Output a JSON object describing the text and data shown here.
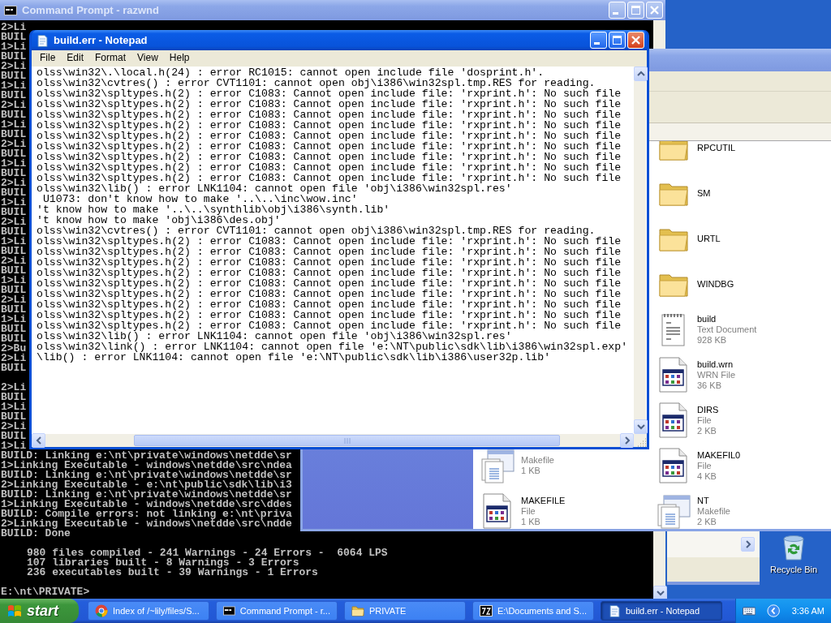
{
  "command_prompt": {
    "title": "Command Prompt - razwnd",
    "active": false,
    "blocks": [
      {
        "indented": false,
        "lines": [
          "2>Li",
          "BUIL",
          "1>Li",
          "BUIL",
          "2>Li",
          "BUIL",
          "1>Li",
          "BUIL",
          "2>Li",
          "BUIL",
          "1>Li",
          "BUIL",
          "2>Li",
          "BUIL",
          "1>Li",
          "BUIL",
          "2>Li",
          "BUIL",
          "1>Li",
          "BUIL",
          "2>Li",
          "BUIL",
          "1>Li",
          "BUIL",
          "2>Li",
          "BUIL",
          "1>Li",
          "BUIL",
          "2>Li",
          "BUIL",
          "1>Li",
          "BUIL",
          "BUIL",
          "2>Bu",
          "2>Li",
          "BUIL"
        ]
      },
      {
        "indented": false,
        "lines": [
          "2>Li",
          "BUIL",
          "1>Li",
          "BUIL",
          "2>Li",
          "BUIL",
          "1>Li",
          "BUILD: Linking e:\\nt\\private\\windows\\netdde\\sr",
          "1>Linking Executable - windows\\netdde\\src\\ndea",
          "BUILD: Linking e:\\nt\\private\\windows\\netdde\\sr",
          "2>Linking Executable - e:\\nt\\public\\sdk\\lib\\i3",
          "BUILD: Linking e:\\nt\\private\\windows\\netdde\\sr",
          "1>Linking Executable - windows\\netdde\\src\\ddes",
          "BUILD: Compile errors: not linking e:\\nt\\priva",
          "2>Linking Executable - windows\\netdde\\src\\ndde",
          "BUILD: Done"
        ]
      },
      {
        "indented": true,
        "lines": [
          "980 files compiled - 241 Warnings - 24 Errors -  6064 LPS",
          "107 libraries built - 8 Warnings - 3 Errors",
          "236 executables built - 39 Warnings - 1 Errors"
        ]
      },
      {
        "indented": false,
        "lines": [
          "E:\\nt\\PRIVATE>"
        ]
      }
    ]
  },
  "explorer": {
    "active": false,
    "rows": [
      {
        "right": {
          "kind": "folder",
          "name": "RPCUTIL"
        }
      },
      {
        "right": {
          "kind": "folder",
          "name": "SM"
        }
      },
      {
        "right": {
          "kind": "folder",
          "name": "URTL"
        }
      },
      {
        "right": {
          "kind": "folder",
          "name": "WINDBG"
        }
      },
      {
        "right": {
          "kind": "text",
          "name": "build",
          "details": [
            "Text Document",
            "928 KB"
          ]
        }
      },
      {
        "right": {
          "kind": "app",
          "name": "build.wrn",
          "details": [
            "WRN File",
            "36 KB"
          ]
        }
      },
      {
        "right": {
          "kind": "app",
          "name": "DIRS",
          "details": [
            "File",
            "2 KB"
          ]
        }
      },
      {
        "left": {
          "kind": "makefile",
          "details": [
            "Makefile",
            "1 KB"
          ]
        },
        "right": {
          "kind": "app",
          "name": "MAKEFIL0",
          "details": [
            "File",
            "4 KB"
          ]
        }
      },
      {
        "left": {
          "kind": "app",
          "name": "MAKEFILE",
          "details": [
            "File",
            "1 KB"
          ]
        },
        "right": {
          "kind": "makefile",
          "name": "NT",
          "details": [
            "Makefile",
            "2 KB"
          ]
        }
      }
    ]
  },
  "notepad": {
    "title": "build.err - Notepad",
    "active": true,
    "menu": [
      "File",
      "Edit",
      "Format",
      "View",
      "Help"
    ],
    "lines": [
      "olss\\win32\\.\\local.h(24) : error RC1015: cannot open include file 'dosprint.h'.",
      "olss\\win32\\cvtres() : error CVT1101: cannot open obj\\i386\\win32spl.tmp.RES for reading.",
      "olss\\win32\\spltypes.h(2) : error C1083: Cannot open include file: 'rxprint.h': No such file",
      "olss\\win32\\spltypes.h(2) : error C1083: Cannot open include file: 'rxprint.h': No such file",
      "olss\\win32\\spltypes.h(2) : error C1083: Cannot open include file: 'rxprint.h': No such file",
      "olss\\win32\\spltypes.h(2) : error C1083: Cannot open include file: 'rxprint.h': No such file",
      "olss\\win32\\spltypes.h(2) : error C1083: Cannot open include file: 'rxprint.h': No such file",
      "olss\\win32\\spltypes.h(2) : error C1083: Cannot open include file: 'rxprint.h': No such file",
      "olss\\win32\\spltypes.h(2) : error C1083: Cannot open include file: 'rxprint.h': No such file",
      "olss\\win32\\spltypes.h(2) : error C1083: Cannot open include file: 'rxprint.h': No such file",
      "olss\\win32\\spltypes.h(2) : error C1083: Cannot open include file: 'rxprint.h': No such file",
      "olss\\win32\\lib() : error LNK1104: cannot open file 'obj\\i386\\win32spl.res'",
      " U1073: don't know how to make '..\\..\\inc\\wow.inc'",
      "'t know how to make '..\\..\\synthlib\\obj\\i386\\synth.lib'",
      "'t know how to make 'obj\\i386\\des.obj'",
      "olss\\win32\\cvtres() : error CVT1101: cannot open obj\\i386\\win32spl.tmp.RES for reading.",
      "olss\\win32\\spltypes.h(2) : error C1083: Cannot open include file: 'rxprint.h': No such file",
      "olss\\win32\\spltypes.h(2) : error C1083: Cannot open include file: 'rxprint.h': No such file",
      "olss\\win32\\spltypes.h(2) : error C1083: Cannot open include file: 'rxprint.h': No such file",
      "olss\\win32\\spltypes.h(2) : error C1083: Cannot open include file: 'rxprint.h': No such file",
      "olss\\win32\\spltypes.h(2) : error C1083: Cannot open include file: 'rxprint.h': No such file",
      "olss\\win32\\spltypes.h(2) : error C1083: Cannot open include file: 'rxprint.h': No such file",
      "olss\\win32\\spltypes.h(2) : error C1083: Cannot open include file: 'rxprint.h': No such file",
      "olss\\win32\\spltypes.h(2) : error C1083: Cannot open include file: 'rxprint.h': No such file",
      "olss\\win32\\spltypes.h(2) : error C1083: Cannot open include file: 'rxprint.h': No such file",
      "olss\\win32\\lib() : error LNK1104: cannot open file 'obj\\i386\\win32spl.res'",
      "olss\\win32\\link() : error LNK1104: cannot open file 'e:\\NT\\public\\sdk\\lib\\i386\\win32spl.exp'",
      "\\lib() : error LNK1104: cannot open file 'e:\\NT\\public\\sdk\\lib\\i386\\user32p.lib'"
    ]
  },
  "desktop": {
    "icons": [
      {
        "kind": "recycle_bin",
        "label": "Recycle Bin"
      }
    ]
  },
  "taskbar": {
    "start_label": "start",
    "clock": "3:36 AM",
    "tasks": [
      {
        "kind": "browser",
        "label": "Index of /~lily/files/S...",
        "selected": false
      },
      {
        "kind": "console",
        "label": "Command Prompt - r...",
        "selected": false
      },
      {
        "kind": "folder",
        "label": "PRIVATE",
        "selected": false
      },
      {
        "kind": "archive",
        "label": "E:\\Documents and S...",
        "selected": false
      },
      {
        "kind": "notepad",
        "label": "build.err - Notepad",
        "selected": true
      }
    ]
  }
}
